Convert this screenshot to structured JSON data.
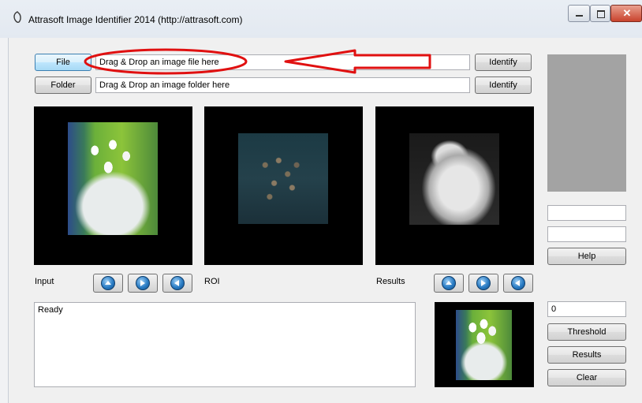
{
  "window": {
    "title": "Attrasoft Image Identifier 2014 (http://attrasoft.com)"
  },
  "row_file": {
    "button_label": "File",
    "field_text": "Drag & Drop an image file here",
    "identify_label": "Identify"
  },
  "row_folder": {
    "button_label": "Folder",
    "field_text": "Drag & Drop an image folder here",
    "identify_label": "Identify"
  },
  "labels": {
    "input": "Input",
    "roi": "ROI",
    "results": "Results"
  },
  "status_text": "Ready",
  "right_panel": {
    "field1_value": "",
    "field2_value": "",
    "help_label": "Help",
    "threshold_value": "0",
    "threshold_label": "Threshold",
    "results_label": "Results",
    "clear_label": "Clear"
  },
  "annotation": {
    "color": "#e01010"
  }
}
